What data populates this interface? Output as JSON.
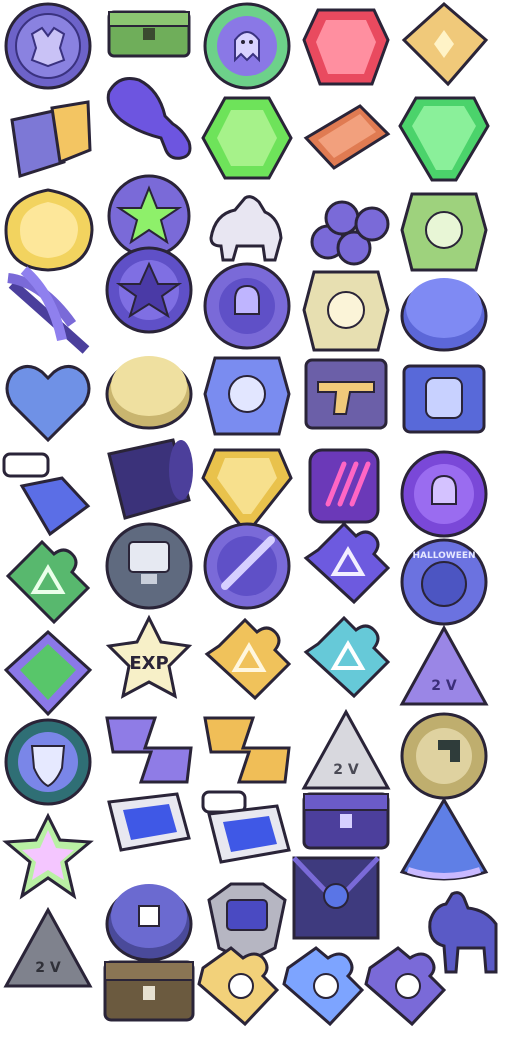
{
  "sheet": {
    "background": "#ffffff"
  },
  "palette": {
    "outline": "#2a2438",
    "purple": "#7a6ad8",
    "purple_dark": "#4b3f9c",
    "purple_light": "#b7acf2",
    "green": "#63d24f",
    "green_dark": "#2f8a3a",
    "gold": "#e8c46a",
    "gold_light": "#f6e4a4",
    "red": "#e74a5e",
    "orange": "#e0764e",
    "blue": "#6f8fe8",
    "grey": "#b9b9c3",
    "wood": "#6a5a3f",
    "navy": "#3e3a7e"
  },
  "labels": {
    "exp": "EXP",
    "halloween": "HALLOWEEN",
    "tier": "2 V"
  },
  "items": [
    {
      "name": "dragon-coin-icon"
    },
    {
      "name": "green-chest-icon"
    },
    {
      "name": "ghost-orb-icon"
    },
    {
      "name": "red-gem-icon"
    },
    {
      "name": "gold-ticket-icon"
    },
    {
      "name": "gold-bucket-icon"
    },
    {
      "name": "drumstick-icon"
    },
    {
      "name": "green-hex-gem-icon"
    },
    {
      "name": "orange-cash-stack-icon"
    },
    {
      "name": "green-crystal-icon"
    },
    {
      "name": "yellow-teardrop-gem-icon"
    },
    {
      "name": "winged-star-badge-icon"
    },
    {
      "name": "horse-statue-icon"
    },
    {
      "name": "purple-logs-icon"
    },
    {
      "name": "green-tower-badge-icon"
    },
    {
      "name": "lavender-bundle-icon"
    },
    {
      "name": "star-coin-icon"
    },
    {
      "name": "skull-coin-icon"
    },
    {
      "name": "tan-tower-badge-icon"
    },
    {
      "name": "blue-rune-coin-icon"
    },
    {
      "name": "blue-heart-icon"
    },
    {
      "name": "gold-rune-coin-icon"
    },
    {
      "name": "blue-tower-badge-icon"
    },
    {
      "name": "pistol-card-icon"
    },
    {
      "name": "fist-card-icon"
    },
    {
      "name": "blue-crystal-shards-icon"
    },
    {
      "name": "dark-barrel-icon"
    },
    {
      "name": "gold-diamond-icon"
    },
    {
      "name": "purple-claw-can-icon"
    },
    {
      "name": "skull-token-icon"
    },
    {
      "name": "green-puzzle-piece-icon"
    },
    {
      "name": "monitor-coin-icon"
    },
    {
      "name": "wrench-coin-icon"
    },
    {
      "name": "purple-puzzle-piece-icon"
    },
    {
      "name": "halloween-coin-icon"
    },
    {
      "name": "green-diamond-card-icon"
    },
    {
      "name": "exp-star-icon"
    },
    {
      "name": "gold-puzzle-piece-icon"
    },
    {
      "name": "cyan-puzzle-piece-icon"
    },
    {
      "name": "purple-triangle-tag-icon"
    },
    {
      "name": "shield-coin-icon"
    },
    {
      "name": "purple-lightning-icon"
    },
    {
      "name": "gold-lightning-icon"
    },
    {
      "name": "silver-triangle-tag-icon"
    },
    {
      "name": "arrow-coin-icon"
    },
    {
      "name": "prism-star-icon"
    },
    {
      "name": "spotlight-icon"
    },
    {
      "name": "spotlight-bonus-icon"
    },
    {
      "name": "purple-chest-icon"
    },
    {
      "name": "watermelon-slice-icon"
    },
    {
      "name": "grey-triangle-tag-icon"
    },
    {
      "name": "square-hole-coin-icon"
    },
    {
      "name": "metal-crest-icon"
    },
    {
      "name": "envelope-badge-icon"
    },
    {
      "name": "horse-figurine-icon"
    },
    {
      "name": "wood-chest-icon"
    },
    {
      "name": "gold-gear-puzzle-icon"
    },
    {
      "name": "blue-gear-puzzle-icon"
    },
    {
      "name": "purple-gear-puzzle-icon"
    }
  ]
}
